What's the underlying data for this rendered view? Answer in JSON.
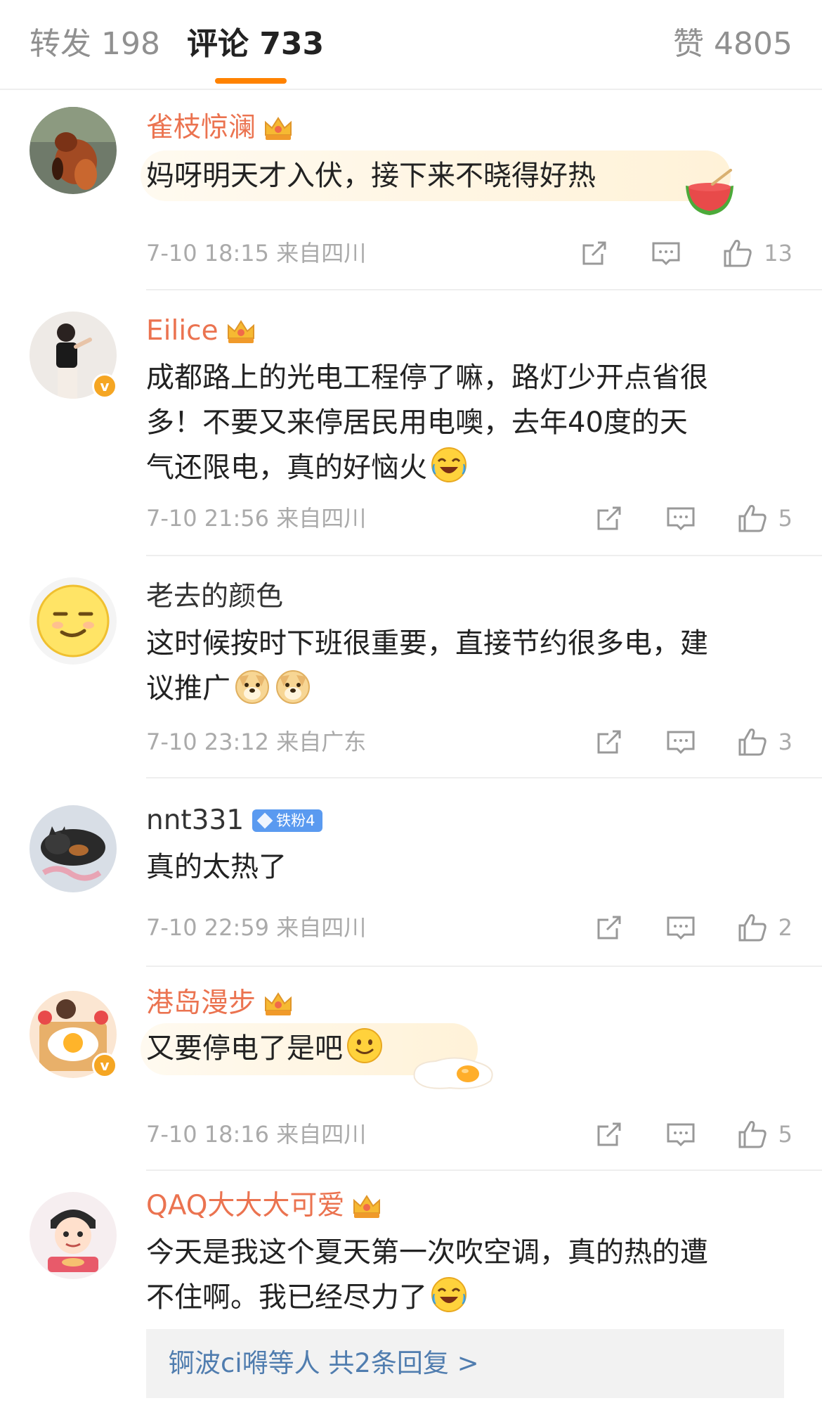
{
  "tabs": {
    "repost": "转发 198",
    "comments": "评论 733",
    "likes": "赞 4805"
  },
  "comments": [
    {
      "username": "雀枝惊澜",
      "text": "妈呀明天才入伏，接下来不晓得好热",
      "meta": "7-10 18:15  来自四川",
      "likes": "13",
      "avatar_icon": "red-panda-avatar",
      "badge_icon": "crown-icon",
      "verified": false
    },
    {
      "username": "Eilice",
      "text_lines": [
        "成都路上的光电工程停了嘛，路灯少开点省很",
        "多！不要又来停居民用电噢，去年40度的天",
        "气还限电，真的好恼火"
      ],
      "meta": "7-10 21:56  来自四川",
      "likes": "5",
      "avatar_icon": "woman-portrait-avatar",
      "badge_icon": "crown-icon",
      "verified": true
    },
    {
      "username": "老去的颜色",
      "text_lines": [
        "这时候按时下班很重要，直接节约很多电，建",
        "议推广"
      ],
      "meta": "7-10 23:12  来自广东",
      "likes": "3",
      "avatar_icon": "smirk-emoji-avatar",
      "verified": false
    },
    {
      "username": "nnt331",
      "fan_badge": "铁粉4",
      "text": "真的太热了",
      "meta": "7-10 22:59  来自四川",
      "likes": "2",
      "avatar_icon": "cat-avatar",
      "verified": false
    },
    {
      "username": "港岛漫步",
      "text": "又要停电了是吧",
      "meta": "7-10 18:16  来自四川",
      "likes": "5",
      "avatar_icon": "cartoon-egg-avatar",
      "badge_icon": "crown-icon",
      "verified": true
    },
    {
      "username": "QAQ大大大可爱",
      "text_lines": [
        "今天是我这个夏天第一次吹空调，真的热的遭",
        "不住啊。我已经尽力了"
      ],
      "meta": "",
      "avatar_icon": "cartoon-girl-avatar",
      "badge_icon": "crown-icon",
      "verified": false,
      "reply_summary": "锕波ci嘚等人  共2条回复 >"
    }
  ],
  "colors": {
    "accent": "#ff8200",
    "vip_name": "#eb7350",
    "link": "#507daf",
    "meta": "#aaaaaa"
  }
}
